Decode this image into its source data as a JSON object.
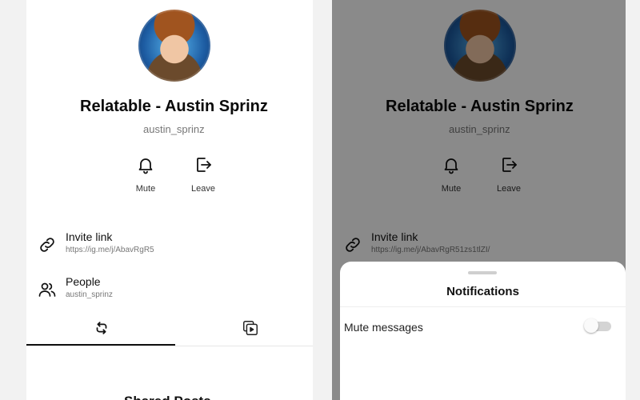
{
  "profile": {
    "name": "Relatable - Austin Sprinz",
    "username": "austin_sprinz"
  },
  "actions": {
    "mute_label": "Mute",
    "leave_label": "Leave"
  },
  "invite": {
    "title": "Invite link",
    "url_left": "https://ig.me/j/AbavRgR5",
    "url_right": "https://ig.me/j/AbavRgR51zs1tlZI/"
  },
  "people": {
    "title": "People",
    "member": "austin_sprinz"
  },
  "tabs": {
    "active": "shared-posts",
    "items": [
      "repost-icon",
      "media-collection-icon"
    ]
  },
  "shared_heading": "Shared Posts",
  "notifications_sheet": {
    "title": "Notifications",
    "mute_messages_label": "Mute messages",
    "mute_messages_on": false
  },
  "colors": {
    "overlay": "#000000",
    "toggle_track_off": "#d4d4d4",
    "avatar_blue": "#1d5ca2"
  }
}
